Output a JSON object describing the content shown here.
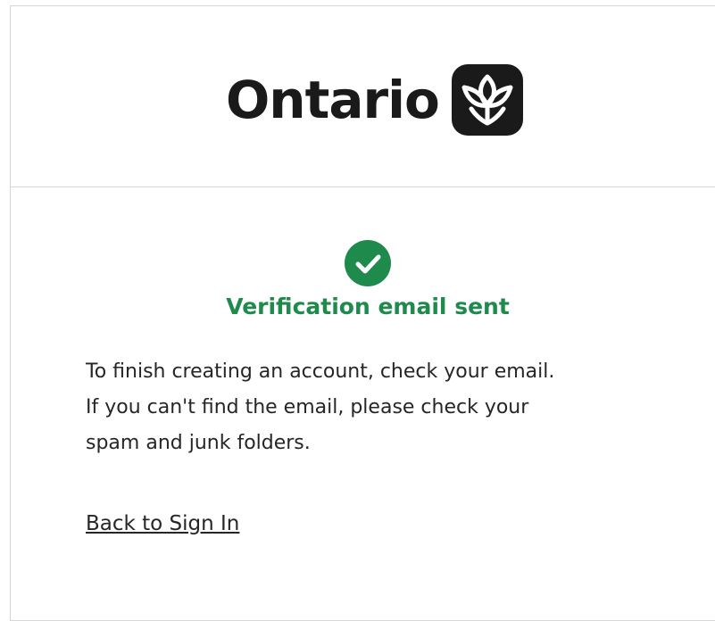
{
  "header": {
    "logo_text": "Ontario",
    "logo_icon": "trillium-icon"
  },
  "status": {
    "icon": "check-circle-icon",
    "icon_color": "#1e8a4c",
    "title": "Verification email sent",
    "title_color": "#1e8a4c"
  },
  "message": {
    "line1": "To finish creating an account, check your email.",
    "line2": "If you can't find the email, please check your",
    "line3": "spam and junk folders."
  },
  "links": {
    "back_to_sign_in": "Back to Sign In"
  }
}
